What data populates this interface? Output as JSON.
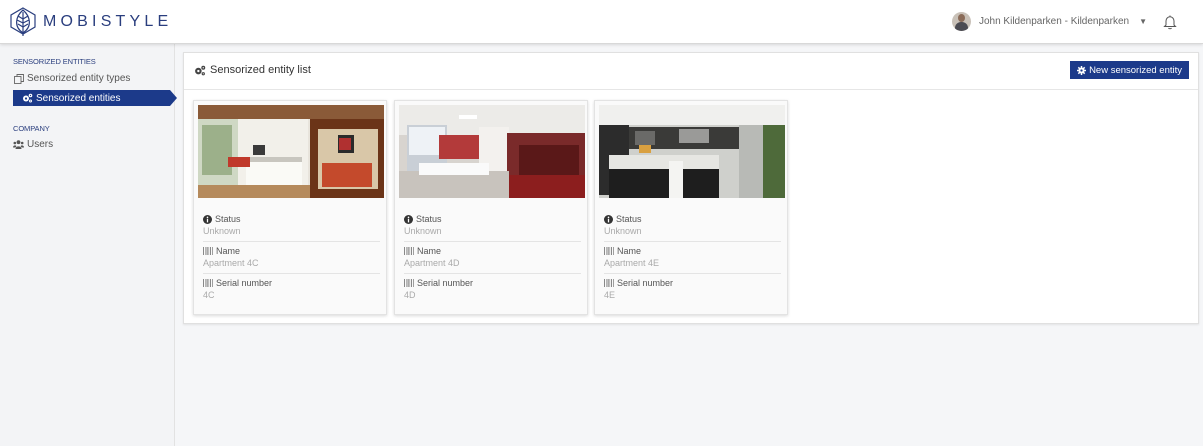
{
  "header": {
    "logo_text": "MOBISTYLE",
    "user_name": "John Kildenparken - Kildenparken",
    "caret": "▼"
  },
  "sidebar": {
    "sections": [
      {
        "title": "SENSORIZED ENTITIES",
        "items": [
          {
            "label": "Sensorized entity types",
            "icon": "copy-icon",
            "active": false
          },
          {
            "label": "Sensorized entities",
            "icon": "cogs-icon",
            "active": true
          }
        ]
      },
      {
        "title": "COMPANY",
        "items": [
          {
            "label": "Users",
            "icon": "users-icon",
            "active": false
          }
        ]
      }
    ]
  },
  "main": {
    "title": "Sensorized entity list",
    "new_button_label": "New sensorized entity",
    "cards": [
      {
        "status_label": "Status",
        "status_value": "Unknown",
        "name_label": "Name",
        "name_value": "Apartment 4C",
        "serial_label": "Serial number",
        "serial_value": "4C"
      },
      {
        "status_label": "Status",
        "status_value": "Unknown",
        "name_label": "Name",
        "name_value": "Apartment 4D",
        "serial_label": "Serial number",
        "serial_value": "4D"
      },
      {
        "status_label": "Status",
        "status_value": "Unknown",
        "name_label": "Name",
        "name_value": "Apartment 4E",
        "serial_label": "Serial number",
        "serial_value": "4E"
      }
    ]
  },
  "colors": {
    "brand": "#1c3a8a",
    "logo": "#2a3e7e"
  }
}
